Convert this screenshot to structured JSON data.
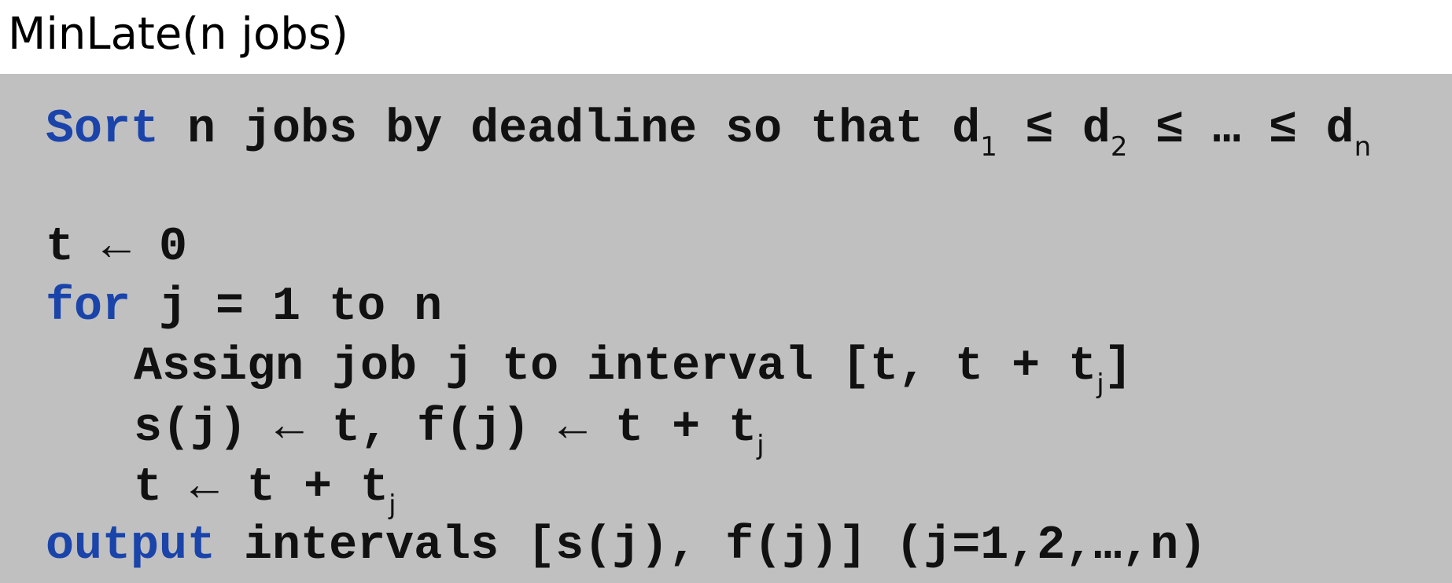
{
  "title": "MinLate(n jobs)",
  "line1": {
    "kw": "Sort",
    "text_a": " n jobs by deadline so that d",
    "sub1": "1",
    "text_b": " ≤ d",
    "sub2": "2",
    "text_c": " ≤ … ≤ d",
    "subn": "n"
  },
  "line2": {
    "text": "t ← 0"
  },
  "line3": {
    "kw": "for",
    "text": " j = 1 to n"
  },
  "line4": {
    "text_a": "Assign job j to interval [t, t + t",
    "sub": "j",
    "text_b": "]"
  },
  "line5": {
    "text_a": "s(j) ← t, f(j) ← t + t",
    "sub": "j"
  },
  "line6": {
    "text_a": "t ← t + t",
    "sub": "j"
  },
  "line7": {
    "kw": "output",
    "text": " intervals [s(j), f(j)] (j=1,2,…,n)"
  }
}
